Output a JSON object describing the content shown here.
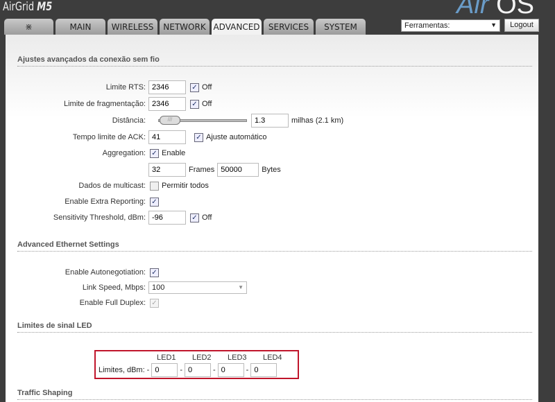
{
  "header": {
    "brand": "AirGrid",
    "brand_model": "M5",
    "logo_air": "Air",
    "logo_os": "OS"
  },
  "tabs": [
    {
      "label": "",
      "icon": "ubiquiti-logo-icon"
    },
    {
      "label": "MAIN"
    },
    {
      "label": "WIRELESS"
    },
    {
      "label": "NETWORK"
    },
    {
      "label": "ADVANCED",
      "active": true
    },
    {
      "label": "SERVICES"
    },
    {
      "label": "SYSTEM"
    }
  ],
  "tools": {
    "selected": "Ferramentas:",
    "logout": "Logout"
  },
  "wireless": {
    "title": "Ajustes avançados da conexão sem fio",
    "rts": {
      "label": "Limite RTS:",
      "value": "2346",
      "off_checked": true,
      "off": "Off"
    },
    "frag": {
      "label": "Limite de fragmentação:",
      "value": "2346",
      "off_checked": true,
      "off": "Off"
    },
    "distance": {
      "label": "Distância:",
      "value": "1.3",
      "unit": "milhas (2.1 km)",
      "slider_fraction": 0.02
    },
    "ack": {
      "label": "Tempo limite de ACK:",
      "value": "41",
      "auto_checked": true,
      "auto": "Ajuste automático"
    },
    "aggregation": {
      "label": "Aggregation:",
      "checked": true,
      "enable": "Enable",
      "frames": "32",
      "frames_unit": "Frames",
      "bytes": "50000",
      "bytes_unit": "Bytes"
    },
    "multicast": {
      "label": "Dados de multicast:",
      "checked": false,
      "text": "Permitir todos"
    },
    "extra": {
      "label": "Enable Extra Reporting:",
      "checked": true
    },
    "sens": {
      "label": "Sensitivity Threshold, dBm:",
      "value": "-96",
      "off_checked": true,
      "off": "Off"
    }
  },
  "ethernet": {
    "title": "Advanced Ethernet Settings",
    "autoneg": {
      "label": "Enable Autonegotiation:",
      "checked": true
    },
    "speed": {
      "label": "Link Speed, Mbps:",
      "value": "100"
    },
    "duplex": {
      "label": "Enable Full Duplex:",
      "checked": true,
      "disabled": true
    }
  },
  "led": {
    "title": "Limites de sinal LED",
    "label": "Limites, dBm:",
    "sep": "-",
    "headers": [
      "LED1",
      "LED2",
      "LED3",
      "LED4"
    ],
    "values": [
      "0",
      "0",
      "0",
      "0"
    ],
    "highlight_color": "#c0142a"
  },
  "traffic": {
    "title": "Traffic Shaping"
  }
}
